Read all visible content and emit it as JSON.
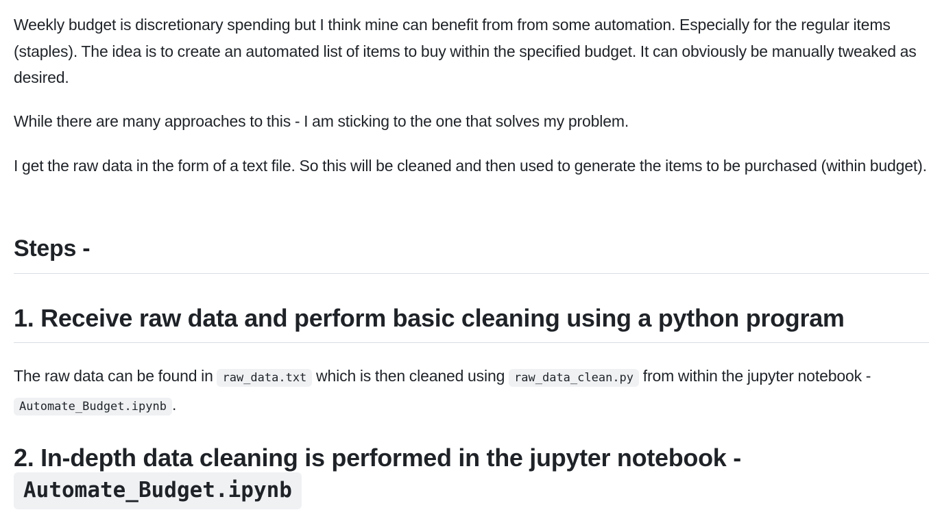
{
  "intro": {
    "paragraph1": "Weekly budget is discretionary spending but I think mine can benefit from from some automation. Especially for the regular items (staples). The idea is to create an automated list of items to buy within the specified budget. It can obviously be manually tweaked as desired.",
    "paragraph2": "While there are many approaches to this - I am sticking to the one that solves my problem.",
    "paragraph3": "I get the raw data in the form of a text file. So this will be cleaned and then used to generate the items to be purchased (within budget)."
  },
  "steps_heading": "Steps -",
  "step1": {
    "heading": "1. Receive raw data and perform basic cleaning using a python program",
    "text_before_code1": "The raw data can be found in ",
    "code1": "raw_data.txt",
    "text_between_codes": " which is then cleaned using ",
    "code2": "raw_data_clean.py",
    "text_before_code3": " from within the jupyter notebook - ",
    "code3": "Automate_Budget.ipynb",
    "text_end": "."
  },
  "step2": {
    "heading_text": "2. In-depth data cleaning is performed in the jupyter notebook -",
    "heading_code": "Automate_Budget.ipynb"
  }
}
